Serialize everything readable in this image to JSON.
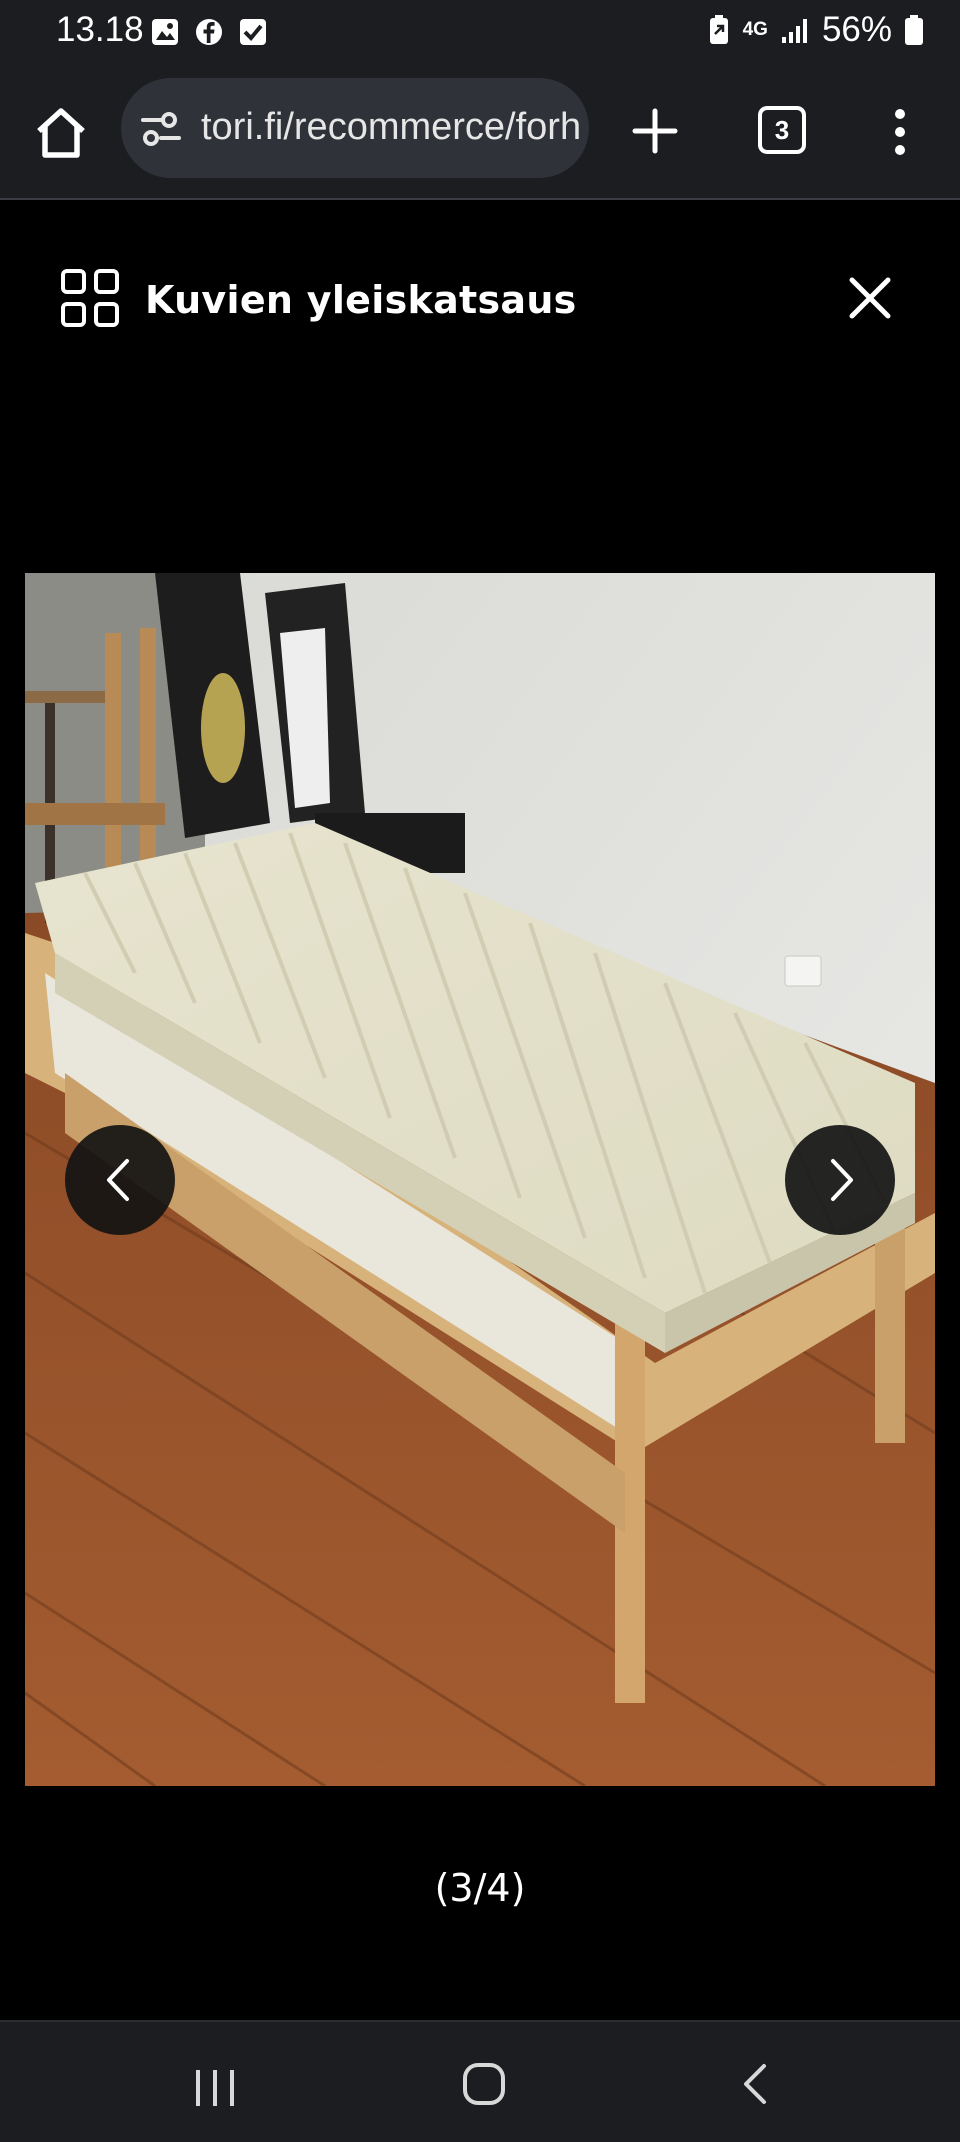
{
  "status_bar": {
    "time": "13.18",
    "network": "4G",
    "battery": "56%"
  },
  "browser": {
    "url": "tori.fi/recommerce/forhandler/item/",
    "tab_count": "3"
  },
  "overview": {
    "title": "Kuvien yleiskatsaus"
  },
  "gallery": {
    "counter": "(3/4)",
    "current": 3,
    "total": 4
  },
  "icons": {
    "home": "home-icon",
    "close": "close-icon",
    "prev": "chevron-left-icon",
    "next": "chevron-right-icon"
  }
}
